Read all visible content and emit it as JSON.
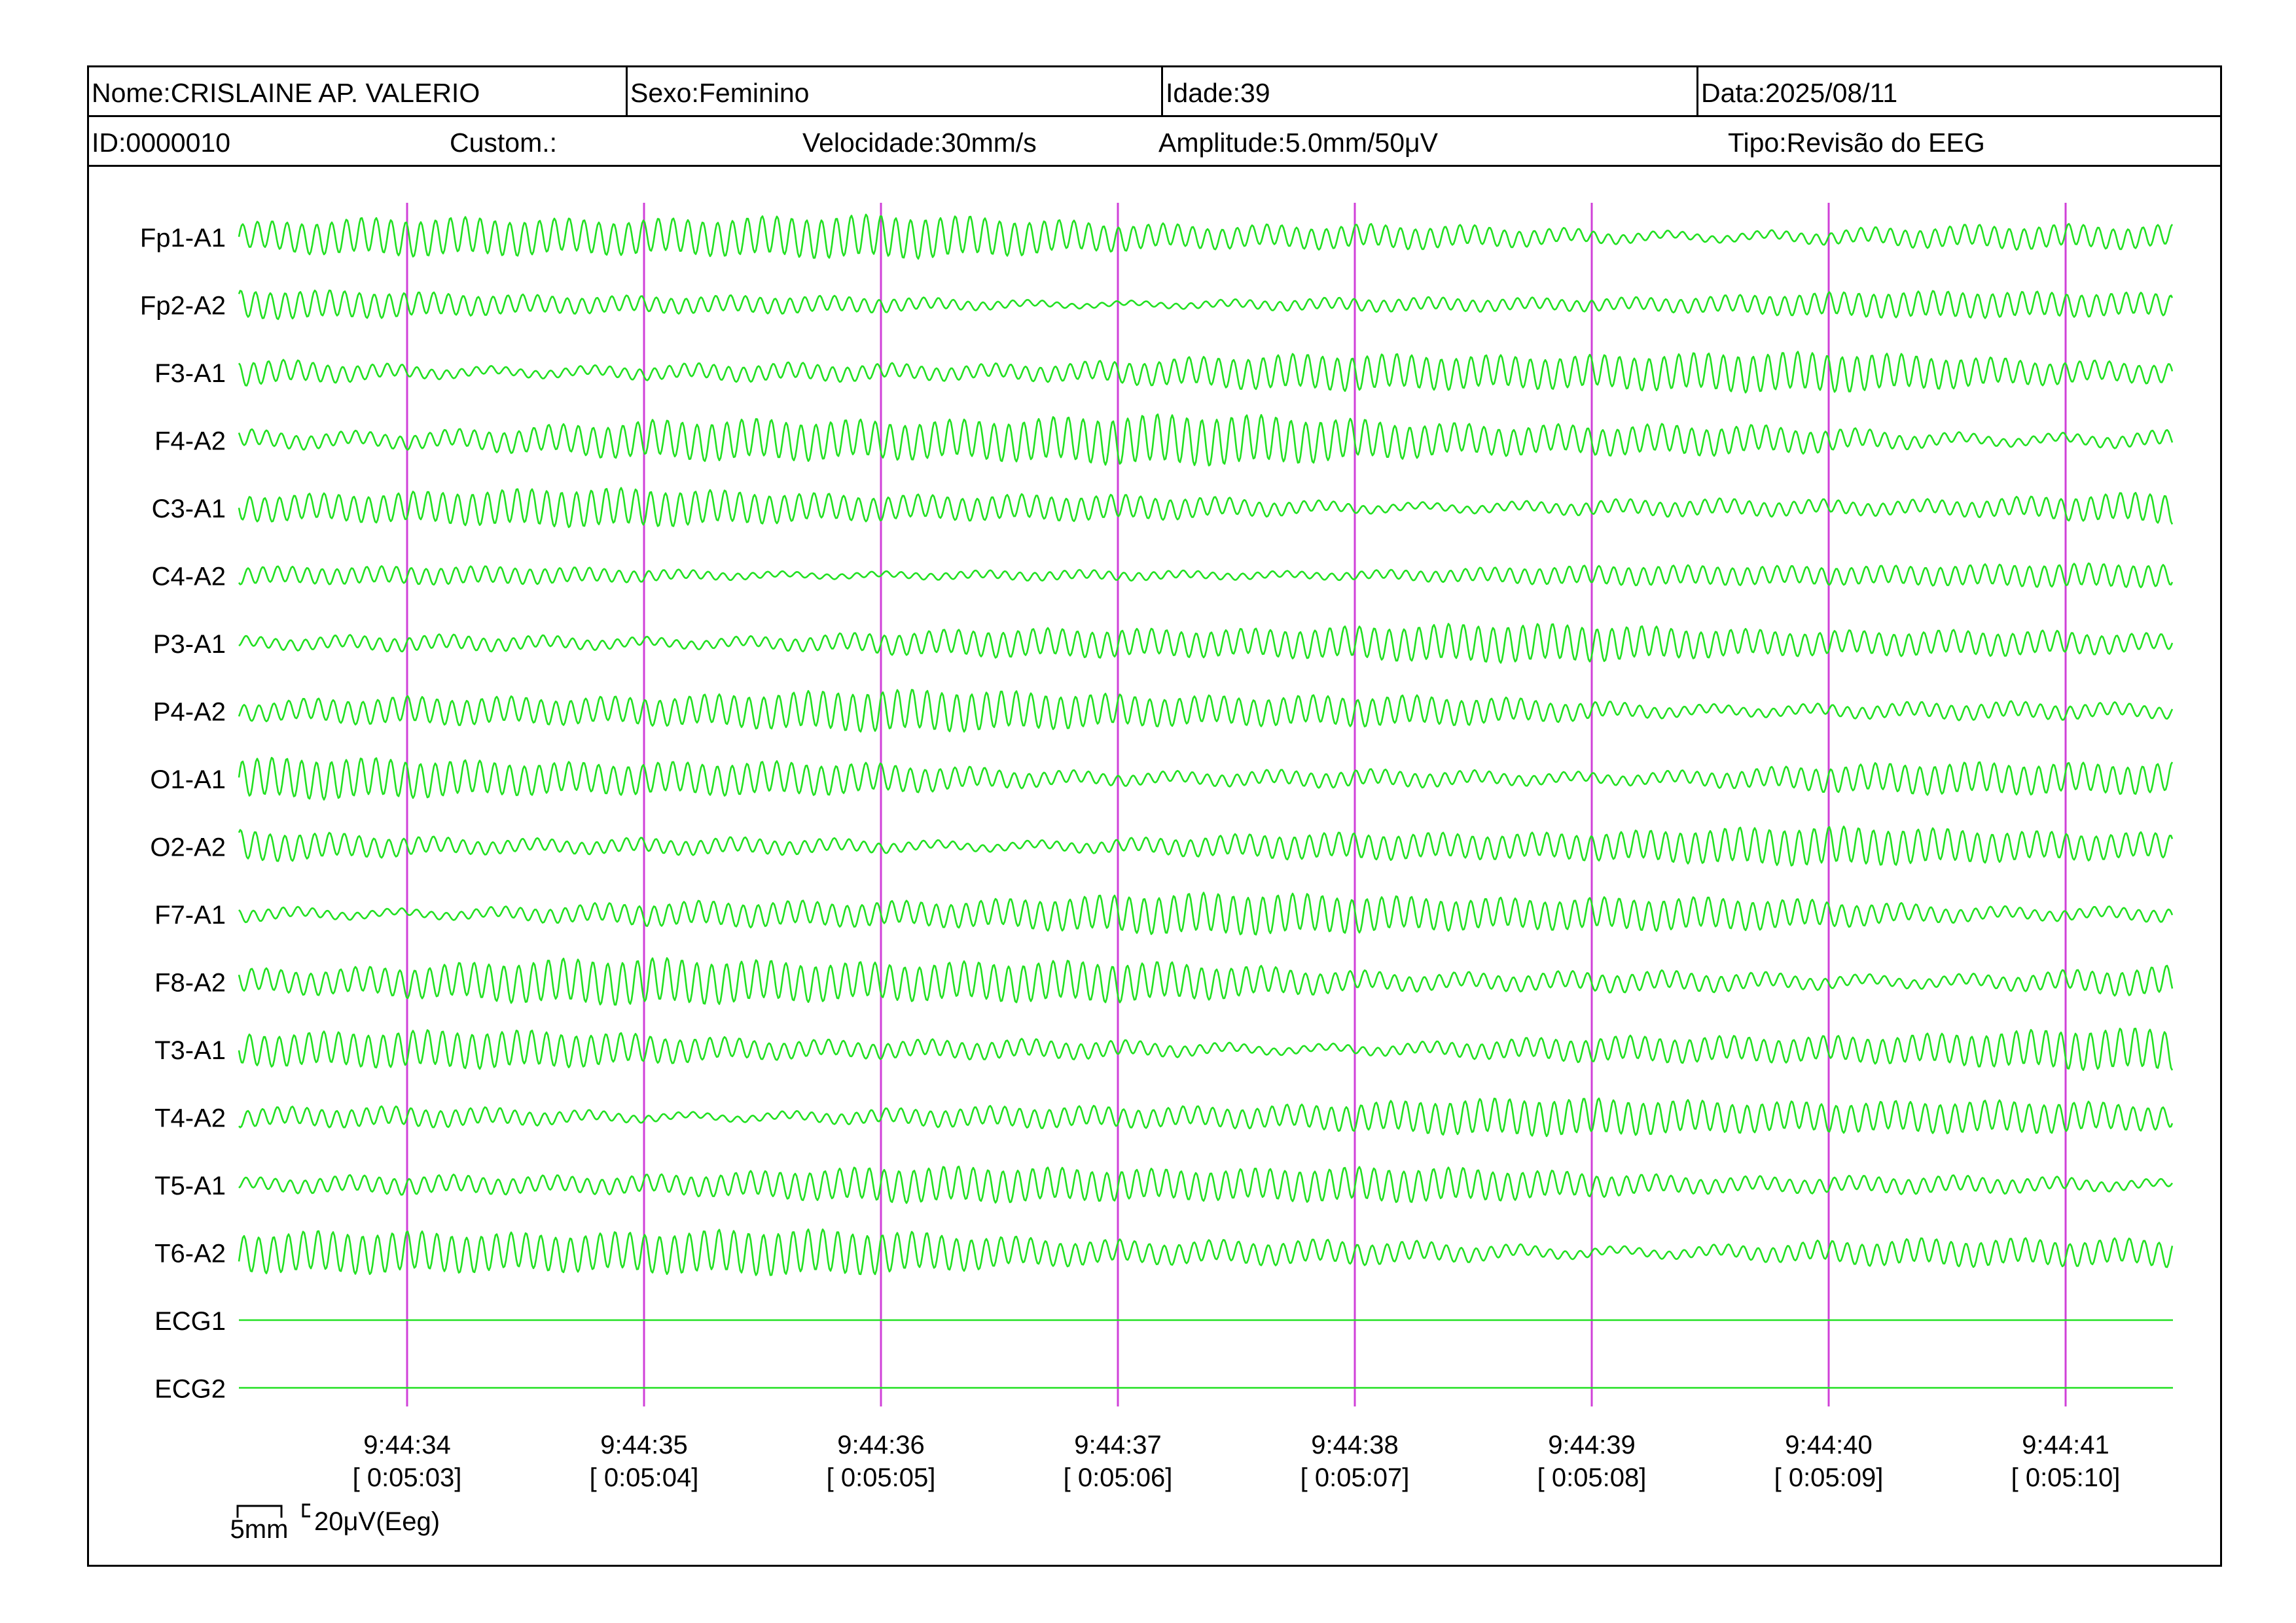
{
  "header": {
    "name": "Nome:CRISLAINE AP. VALERIO",
    "sex": "Sexo:Feminino",
    "age": "Idade:39",
    "date": "Data:2025/08/11",
    "id": "ID:0000010",
    "custom": "Custom.:",
    "speed": "Velocidade:30mm/s",
    "amplitude": "Amplitude:5.0mm/50μV",
    "type": "Tipo:Revisão do EEG"
  },
  "colors": {
    "trace": "#22e022",
    "marker": "#d040d8",
    "frame": "#000000"
  },
  "chart_data": {
    "type": "line",
    "channels": [
      {
        "label": "Fp1-A1",
        "amplitude": 28
      },
      {
        "label": "Fp2-A2",
        "amplitude": 18
      },
      {
        "label": "F3-A1",
        "amplitude": 26
      },
      {
        "label": "F4-A2",
        "amplitude": 32
      },
      {
        "label": "C3-A1",
        "amplitude": 24
      },
      {
        "label": "C4-A2",
        "amplitude": 15
      },
      {
        "label": "P3-A1",
        "amplitude": 24
      },
      {
        "label": "P4-A2",
        "amplitude": 26
      },
      {
        "label": "O1-A1",
        "amplitude": 26
      },
      {
        "label": "O2-A2",
        "amplitude": 24
      },
      {
        "label": "F7-A1",
        "amplitude": 26
      },
      {
        "label": "F8-A2",
        "amplitude": 30
      },
      {
        "label": "T3-A1",
        "amplitude": 26
      },
      {
        "label": "T4-A2",
        "amplitude": 24
      },
      {
        "label": "T5-A1",
        "amplitude": 24
      },
      {
        "label": "T6-A2",
        "amplitude": 30
      },
      {
        "label": "ECG1",
        "amplitude": 0
      },
      {
        "label": "ECG2",
        "amplitude": 0
      }
    ],
    "time_markers": [
      {
        "time": "9:44:34",
        "elapsed": "[ 0:05:03]"
      },
      {
        "time": "9:44:35",
        "elapsed": "[ 0:05:04]"
      },
      {
        "time": "9:44:36",
        "elapsed": "[ 0:05:05]"
      },
      {
        "time": "9:44:37",
        "elapsed": "[ 0:05:06]"
      },
      {
        "time": "9:44:38",
        "elapsed": "[ 0:05:07]"
      },
      {
        "time": "9:44:39",
        "elapsed": "[ 0:05:08]"
      },
      {
        "time": "9:44:40",
        "elapsed": "[ 0:05:09]"
      },
      {
        "time": "9:44:41",
        "elapsed": "[ 0:05:10]"
      }
    ],
    "scale": {
      "time_label": "5mm",
      "amp_label": "20μV(Eeg)"
    }
  }
}
